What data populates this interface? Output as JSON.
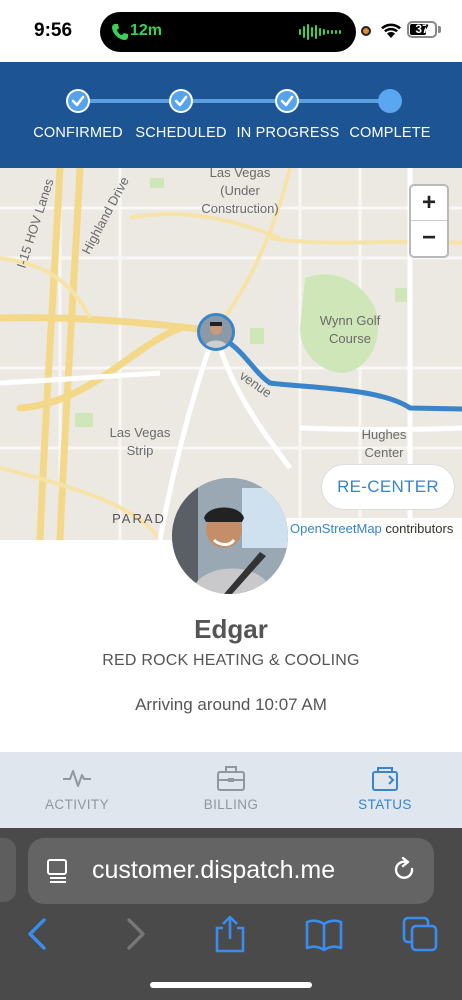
{
  "status_bar": {
    "time": "9:56",
    "call_duration": "12m",
    "battery": "37"
  },
  "progress": {
    "steps": [
      {
        "label": "CONFIRMED",
        "done": true
      },
      {
        "label": "SCHEDULED",
        "done": true
      },
      {
        "label": "IN PROGRESS",
        "done": true
      },
      {
        "label": "COMPLETE",
        "done": false
      }
    ]
  },
  "map": {
    "labels": {
      "las_vegas_under": "Las Vegas (Under Construction)",
      "i15": "I-15 HOV Lanes",
      "highland": "Highland Drive",
      "wynn": "Wynn Golf Course",
      "strip": "Las Vegas Strip",
      "hughes": "Hughes Center",
      "parad": "PARAD",
      "avenue": "venue"
    },
    "zoom_in": "+",
    "zoom_out": "−",
    "recenter": "RE-CENTER",
    "attribution_link": "OpenStreetMap",
    "attribution_rest": " contributors"
  },
  "technician": {
    "name": "Edgar",
    "company": "RED ROCK HEATING & COOLING",
    "eta": "Arriving around 10:07 AM"
  },
  "tabs": [
    {
      "label": "ACTIVITY",
      "icon": "activity-icon",
      "active": false
    },
    {
      "label": "BILLING",
      "icon": "briefcase-icon",
      "active": false
    },
    {
      "label": "STATUS",
      "icon": "status-icon",
      "active": true
    }
  ],
  "browser": {
    "url": "customer.dispatch.me"
  },
  "colors": {
    "header_blue": "#1d5594",
    "accent_blue": "#3a84c9",
    "tab_bar": "#dfe6ee"
  }
}
